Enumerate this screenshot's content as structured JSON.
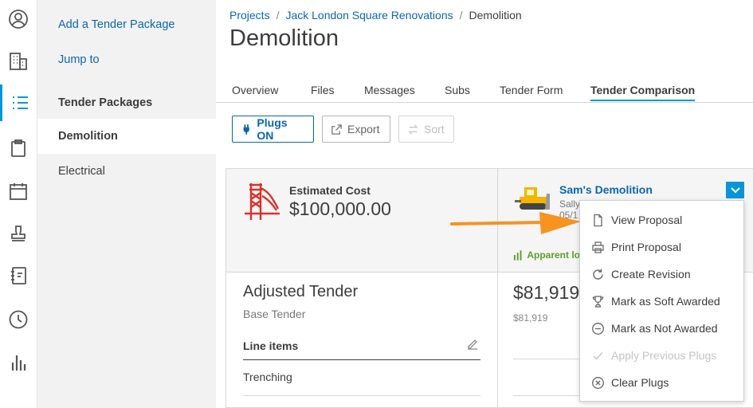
{
  "rail": {
    "items": [
      {
        "icon": "user-icon"
      },
      {
        "icon": "building-icon"
      },
      {
        "icon": "list-icon",
        "active": true
      },
      {
        "icon": "clipboard-icon"
      },
      {
        "icon": "calendar-icon"
      },
      {
        "icon": "stamp-icon"
      },
      {
        "icon": "notebook-icon"
      },
      {
        "icon": "clock-icon"
      },
      {
        "icon": "bar-chart-icon"
      }
    ],
    "accent": "#0696d7"
  },
  "sidebar": {
    "add_link": "Add a Tender Package",
    "jump_link": "Jump to",
    "heading": "Tender Packages",
    "items": [
      {
        "label": "Demolition",
        "selected": true
      },
      {
        "label": "Electrical",
        "selected": false
      }
    ]
  },
  "breadcrumb": {
    "items": [
      "Projects",
      "Jack London Square Renovations",
      "Demolition"
    ],
    "separator": "/"
  },
  "page": {
    "title": "Demolition"
  },
  "tabs": [
    "Overview",
    "Files",
    "Messages",
    "Subs",
    "Tender Form",
    "Tender Comparison"
  ],
  "active_tab": "Tender Comparison",
  "toolbar": {
    "plugs_label": "Plugs ON",
    "export_label": "Export",
    "sort_label": "Sort"
  },
  "estimate": {
    "label": "Estimated Cost",
    "value": "$100,000.00"
  },
  "adjusted": {
    "title": "Adjusted Tender",
    "subtitle": "Base Tender",
    "line_items_header": "Line items",
    "rows": [
      "Trenching"
    ]
  },
  "bidder": {
    "name": "Sam's Demolition",
    "contact_partial": "Sally",
    "date_partial": "05/1",
    "apparent_partial": "Apparent lo",
    "total_partial": "$81,919",
    "base_value": "$81,919"
  },
  "menu": {
    "items": [
      {
        "label": "View Proposal",
        "icon": "document-icon",
        "disabled": false
      },
      {
        "label": "Print Proposal",
        "icon": "printer-icon",
        "disabled": false
      },
      {
        "label": "Create Revision",
        "icon": "refresh-icon",
        "disabled": false
      },
      {
        "label": "Mark as Soft Awarded",
        "icon": "trophy-icon",
        "disabled": false
      },
      {
        "label": "Mark as Not Awarded",
        "icon": "minus-circle-icon",
        "disabled": false
      },
      {
        "label": "Apply Previous Plugs",
        "icon": "check-icon",
        "disabled": true
      },
      {
        "label": "Clear Plugs",
        "icon": "x-circle-icon",
        "disabled": false
      }
    ]
  },
  "colors": {
    "link": "#0a67b0",
    "accent": "#0696d7",
    "annotation_arrow": "#f7931e",
    "apparent_green": "#5b9e2d"
  }
}
